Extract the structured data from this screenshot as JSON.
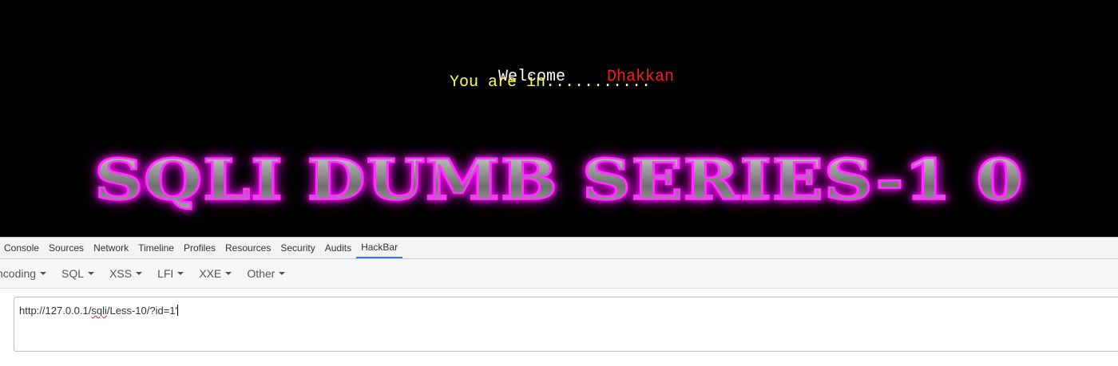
{
  "page": {
    "welcome_label": "Welcome",
    "user_name": "Dhakkan",
    "status_message": "You are in...........",
    "banner_title": "SQLI DUMB SERIES-1 0",
    "colors": {
      "background": "#000000",
      "welcome": "#ffffff",
      "user_name": "#ff1a1a",
      "status": "#ffff33",
      "banner_glow": "#ff33ff"
    }
  },
  "devtools": {
    "tabs": [
      {
        "label": "Console"
      },
      {
        "label": "Sources"
      },
      {
        "label": "Network"
      },
      {
        "label": "Timeline"
      },
      {
        "label": "Profiles"
      },
      {
        "label": "Resources"
      },
      {
        "label": "Security"
      },
      {
        "label": "Audits"
      },
      {
        "label": "HackBar",
        "active": true
      }
    ],
    "active_tab_color": "#3879d9"
  },
  "hackbar": {
    "menus": [
      {
        "label": "ncoding"
      },
      {
        "label": "SQL"
      },
      {
        "label": "XSS"
      },
      {
        "label": "LFI"
      },
      {
        "label": "XXE"
      },
      {
        "label": "Other"
      }
    ],
    "url": {
      "part1": "http://127.0.0.1/",
      "part2": "sqli",
      "part3": "/Less-10/?id=1'"
    }
  }
}
